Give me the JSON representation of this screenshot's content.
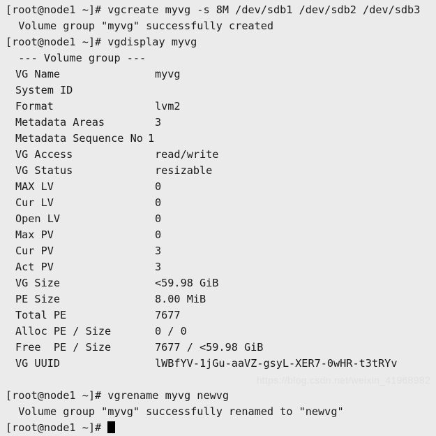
{
  "terminal": {
    "background_color": "#ebebeb",
    "foreground_color": "#1a1a1a",
    "cursor_color": "#000000",
    "lines": [
      {
        "type": "command",
        "text": "[root@node1 ~]# vgcreate myvg -s 8M /dev/sdb1 /dev/sdb2 /dev/sdb3"
      },
      {
        "type": "output",
        "text": "  Volume group \"myvg\" successfully created"
      },
      {
        "type": "command",
        "text": "[root@node1 ~]# vgdisplay myvg"
      },
      {
        "type": "output",
        "text": "  --- Volume group ---"
      }
    ],
    "vg_header": "  --- Volume group ---",
    "prompt_1": "[root@node1 ~]# vgcreate myvg -s 8M /dev/sdb1 /dev/sdb2 /dev/sdb3",
    "output_1": "  Volume group \"myvg\" successfully created",
    "prompt_2": "[root@node1 ~]# vgdisplay myvg",
    "prompt_3": "[root@node1 ~]# vgrename myvg newvg",
    "output_3": "  Volume group \"myvg\" successfully renamed to \"newvg\"",
    "prompt_4": "[root@node1 ~]# "
  },
  "vgdisplay": {
    "fields": [
      {
        "key": "VG Name",
        "value": "myvg",
        "wide": false
      },
      {
        "key": "System ID",
        "value": "",
        "wide": false
      },
      {
        "key": "Format",
        "value": "lvm2",
        "wide": false
      },
      {
        "key": "Metadata Areas",
        "value": "3",
        "wide": false
      },
      {
        "key": "Metadata Sequence No",
        "value": "1",
        "wide": true
      },
      {
        "key": "VG Access",
        "value": "read/write",
        "wide": false
      },
      {
        "key": "VG Status",
        "value": "resizable",
        "wide": false
      },
      {
        "key": "MAX LV",
        "value": "0",
        "wide": false
      },
      {
        "key": "Cur LV",
        "value": "0",
        "wide": false
      },
      {
        "key": "Open LV",
        "value": "0",
        "wide": false
      },
      {
        "key": "Max PV",
        "value": "0",
        "wide": false
      },
      {
        "key": "Cur PV",
        "value": "3",
        "wide": false
      },
      {
        "key": "Act PV",
        "value": "3",
        "wide": false
      },
      {
        "key": "VG Size",
        "value": "<59.98 GiB",
        "wide": false
      },
      {
        "key": "PE Size",
        "value": "8.00 MiB",
        "wide": false
      },
      {
        "key": "Total PE",
        "value": "7677",
        "wide": false
      },
      {
        "key": "Alloc PE / Size",
        "value": "0 / 0",
        "wide": false
      },
      {
        "key": "Free  PE / Size",
        "value": "7677 / <59.98 GiB",
        "wide": false
      },
      {
        "key": "VG UUID",
        "value": "lWBfYV-1jGu-aaVZ-gsyL-XER7-0wHR-t3tRYv",
        "wide": false
      }
    ]
  },
  "watermark": {
    "text": "https://blog.csdn.net/weixin_41968982",
    "color": "#e0e0e0"
  }
}
